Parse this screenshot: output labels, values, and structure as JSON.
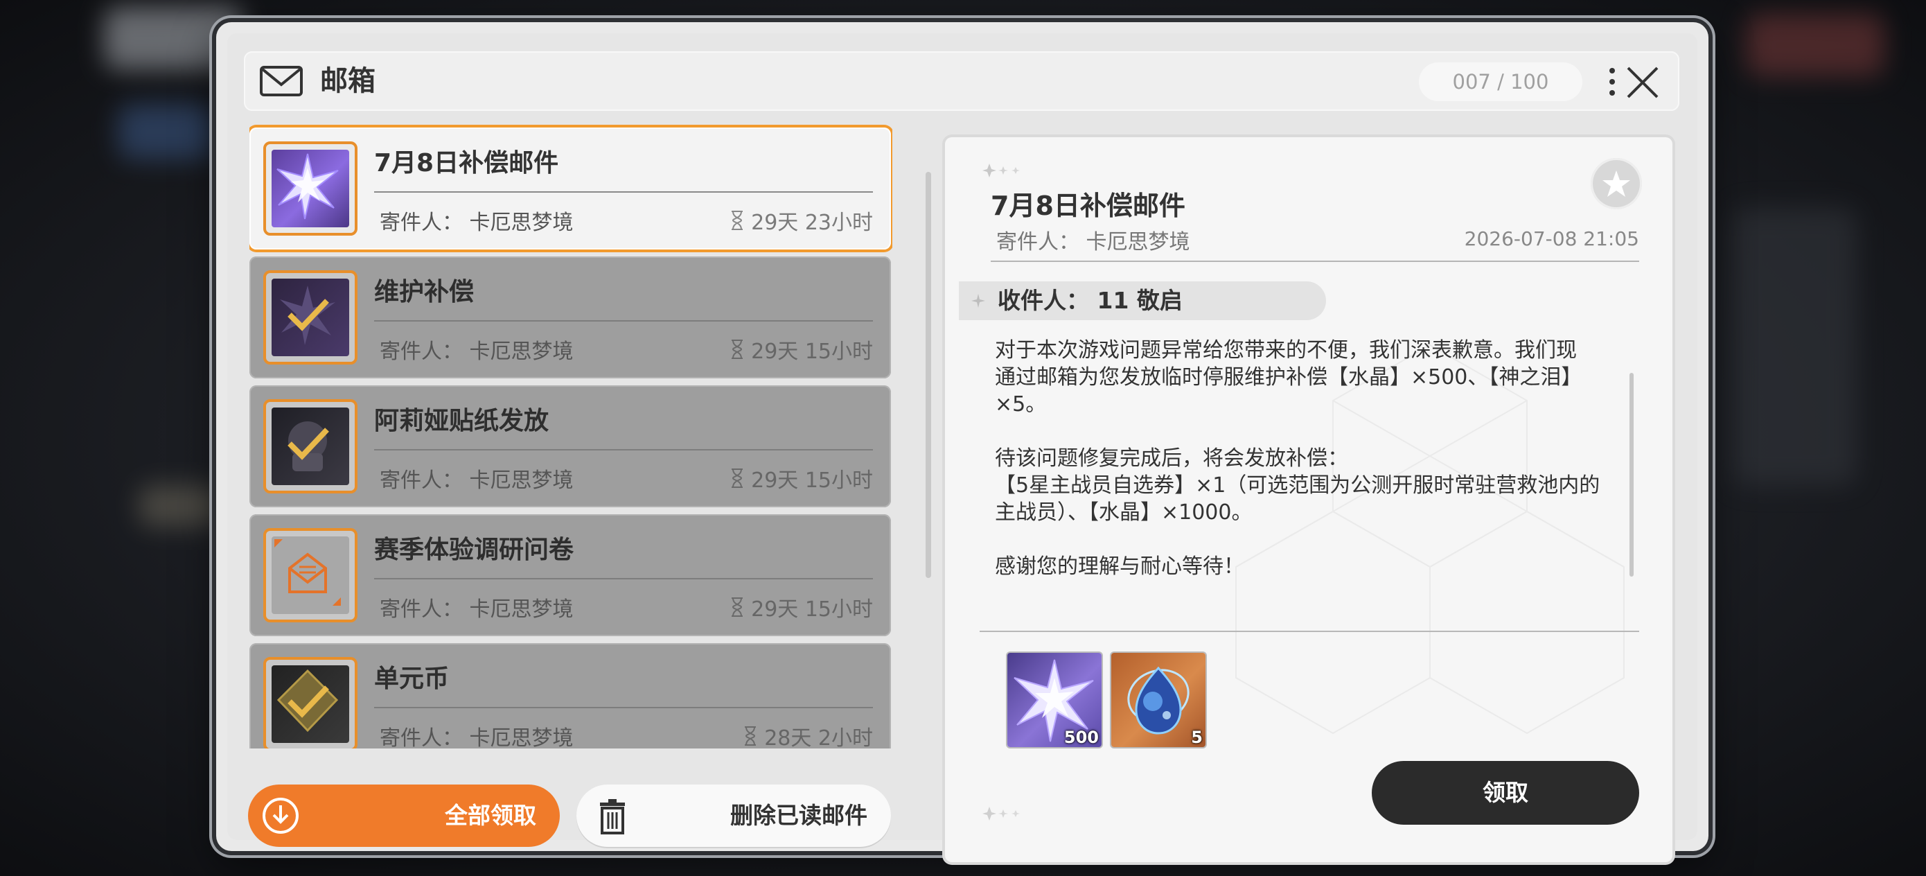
{
  "header": {
    "title": "邮箱",
    "counter": "007 / 100"
  },
  "mails": [
    {
      "title": "7月8日补偿邮件",
      "sender": "寄件人： 卡厄思梦境",
      "expires": "29天 23小时",
      "icon": "crystal-star-icon",
      "state": "selected"
    },
    {
      "title": "维护补偿",
      "sender": "寄件人： 卡厄思梦境",
      "expires": "29天 15小时",
      "icon": "claimed-check-icon",
      "state": "read"
    },
    {
      "title": "阿莉娅贴纸发放",
      "sender": "寄件人： 卡厄思梦境",
      "expires": "29天 15小时",
      "icon": "claimed-check-icon",
      "state": "read"
    },
    {
      "title": "赛季体验调研问卷",
      "sender": "寄件人： 卡厄思梦境",
      "expires": "29天 15小时",
      "icon": "envelope-open-icon",
      "state": "read"
    },
    {
      "title": "单元币",
      "sender": "寄件人： 卡厄思梦境",
      "expires": "28天 2小时",
      "icon": "claimed-check-icon",
      "state": "read"
    }
  ],
  "actions": {
    "claim_all": "全部领取",
    "delete_read": "删除已读邮件",
    "claim": "领取"
  },
  "detail": {
    "title": "7月8日补偿邮件",
    "sender": "寄件人： 卡厄思梦境",
    "date": "2026-07-08 21:05",
    "recipient": "收件人： 11 敬启",
    "body": "对于本次游戏问题异常给您带来的不便，我们深表歉意。我们现\n通过邮箱为您发放临时停服维护补偿【水晶】×500、【神之泪】\n×5。\n\n待该问题修复完成后，将会发放补偿：\n【5星主战员自选券】×1（可选范围为公测开服时常驻营救池内的\n主战员）、【水晶】×1000。\n\n感谢您的理解与耐心等待！",
    "rewards": [
      {
        "name": "crystal-icon",
        "qty": "500",
        "color": "#7a6bc8"
      },
      {
        "name": "tear-of-god-icon",
        "qty": "5",
        "color": "#c9773f"
      }
    ]
  },
  "colors": {
    "accent_orange": "#f07b2a",
    "selected_border": "#f29a2e",
    "dark_button": "#2b2b2b"
  }
}
